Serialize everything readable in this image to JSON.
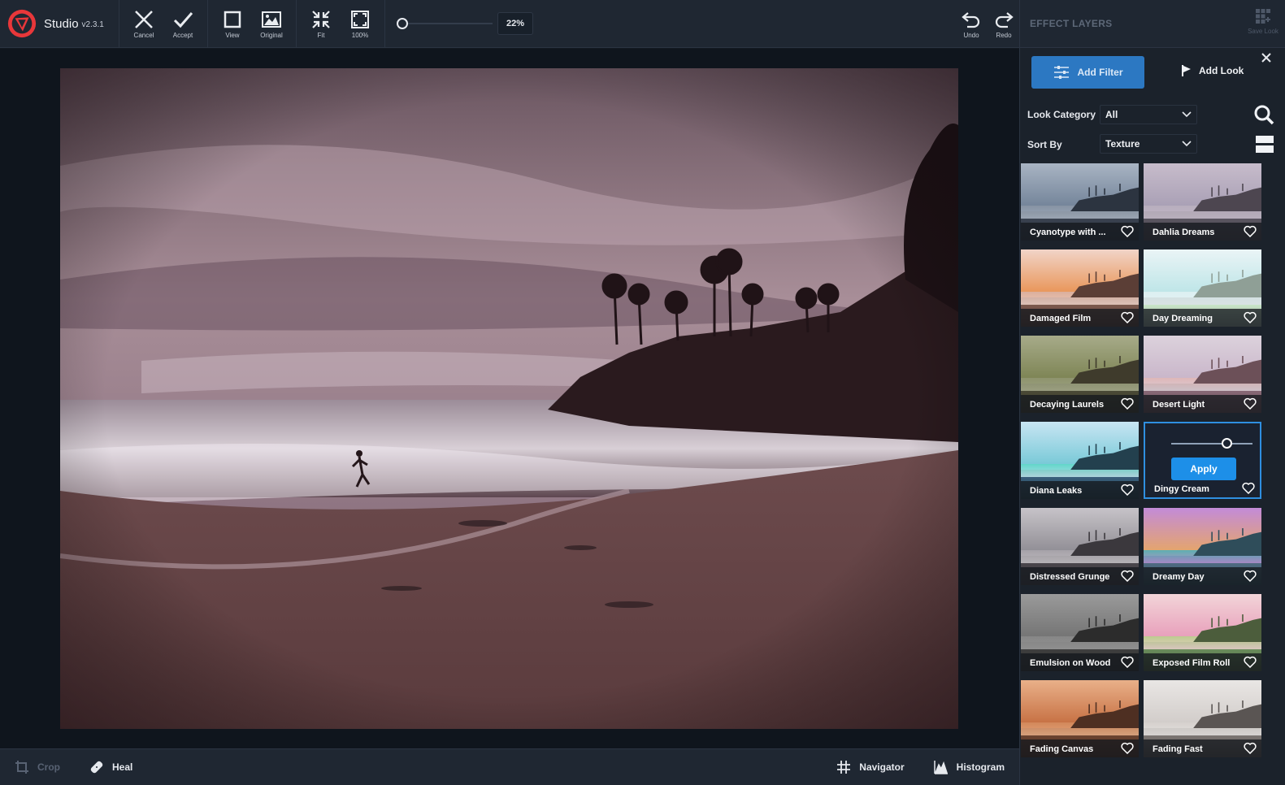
{
  "app": {
    "name": "Studio",
    "version": "v2.3.1"
  },
  "toolbar": {
    "cancel": "Cancel",
    "accept": "Accept",
    "view": "View",
    "original": "Original",
    "fit": "Fit",
    "full": "100%",
    "zoom_value": "22%",
    "zoom_level": 0.22,
    "undo": "Undo",
    "redo": "Redo"
  },
  "bottom": {
    "crop": "Crop",
    "heal": "Heal",
    "navigator": "Navigator",
    "histogram": "Histogram"
  },
  "panel": {
    "title": "EFFECT LAYERS",
    "save_look": "Save Look",
    "add_filter": "Add Filter",
    "add_look": "Add Look",
    "look_category_label": "Look Category",
    "look_category_value": "All",
    "sort_by_label": "Sort By",
    "sort_by_value": "Texture",
    "apply": "Apply",
    "looks": [
      {
        "name": "Cyanotype with ...",
        "tone": "cyan"
      },
      {
        "name": "Dahlia Dreams",
        "tone": "lavender"
      },
      {
        "name": "Damaged Film",
        "tone": "warm"
      },
      {
        "name": "Day Dreaming",
        "tone": "bright"
      },
      {
        "name": "Decaying Laurels",
        "tone": "olive"
      },
      {
        "name": "Desert Light",
        "tone": "rose"
      },
      {
        "name": "Diana Leaks",
        "tone": "teal"
      },
      {
        "name": "Dingy Cream",
        "tone": "selected"
      },
      {
        "name": "Distressed Grunge",
        "tone": "grey"
      },
      {
        "name": "Dreamy Day",
        "tone": "rainbow"
      },
      {
        "name": "Emulsion on Wood",
        "tone": "mono"
      },
      {
        "name": "Exposed Film Roll",
        "tone": "pinkgreen"
      },
      {
        "name": "Fading Canvas",
        "tone": "orange"
      },
      {
        "name": "Fading Fast",
        "tone": "faded"
      }
    ]
  },
  "colors": {
    "accent": "#2c78c2",
    "apply": "#1d8fe8",
    "selected_border": "#2f8fe0"
  }
}
